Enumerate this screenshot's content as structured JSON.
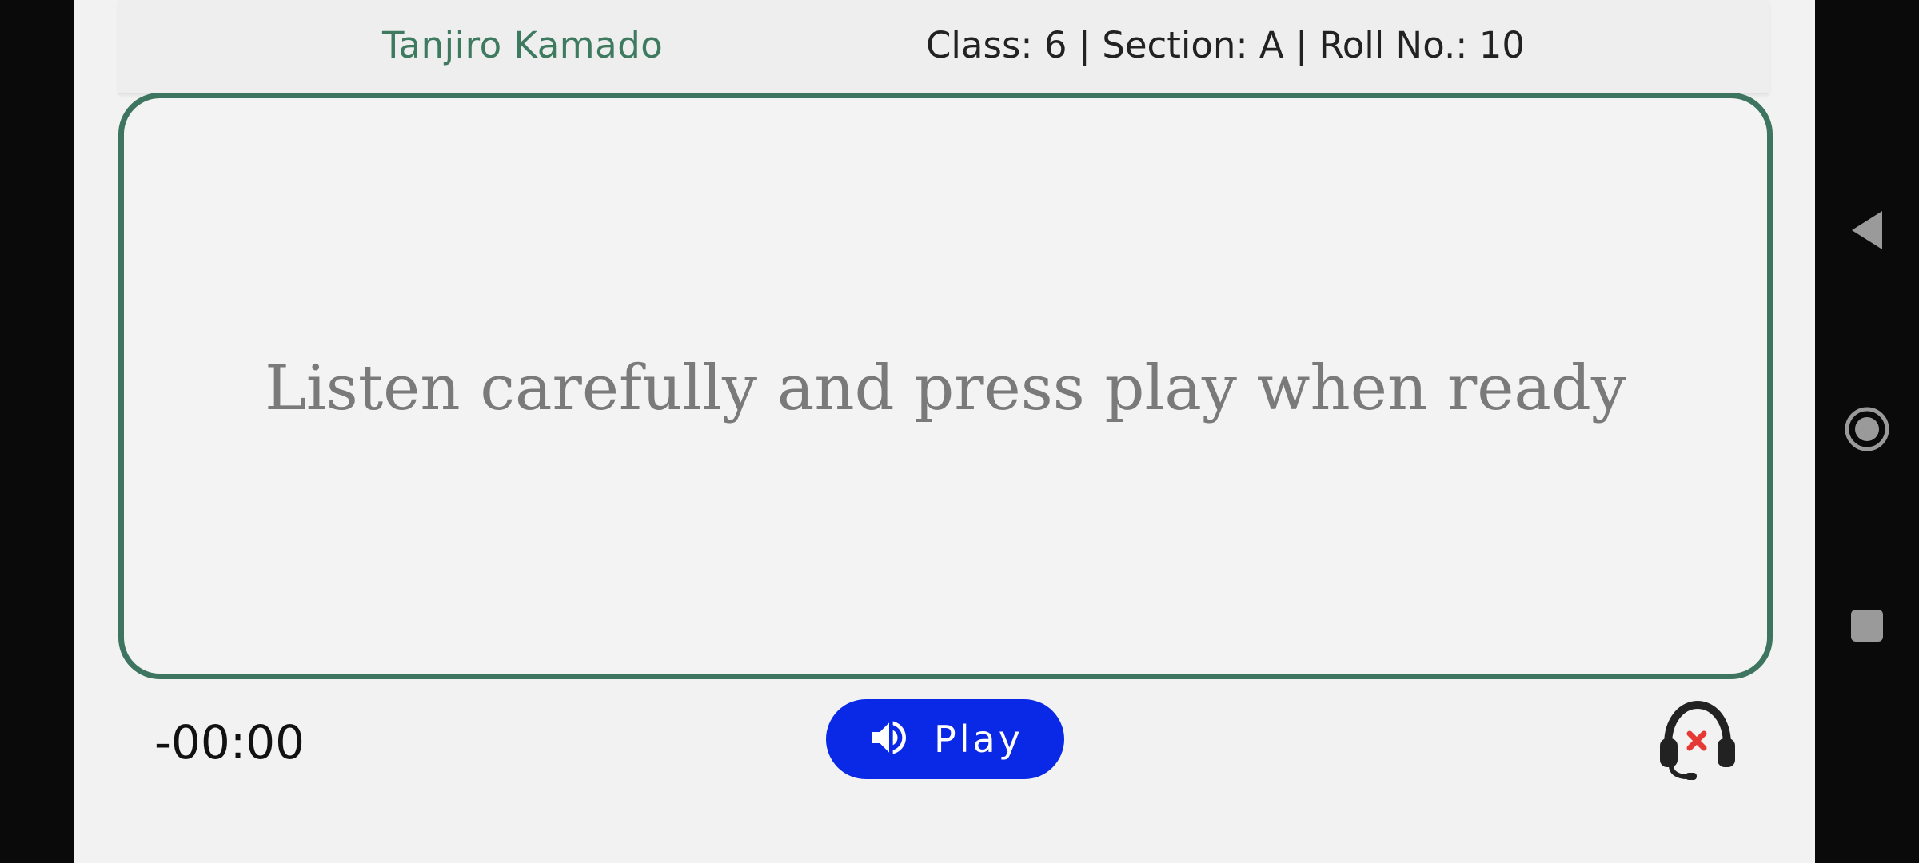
{
  "header": {
    "student_name": "Tanjiro Kamado",
    "student_meta": "Class: 6 | Section: A | Roll No.: 10"
  },
  "card": {
    "instruction": "Listen carefully and press play when ready"
  },
  "player": {
    "timer": "-00:00",
    "play_label": "Play",
    "play_icon": "speaker-icon",
    "headset_icon": "headset-disconnected-icon"
  },
  "colors": {
    "accent_green": "#3e7560",
    "play_blue": "#0a29e6",
    "error_red": "#e53935"
  },
  "system_nav": {
    "back_icon": "back-triangle-icon",
    "home_icon": "home-circle-icon",
    "recents_icon": "recents-square-icon"
  }
}
